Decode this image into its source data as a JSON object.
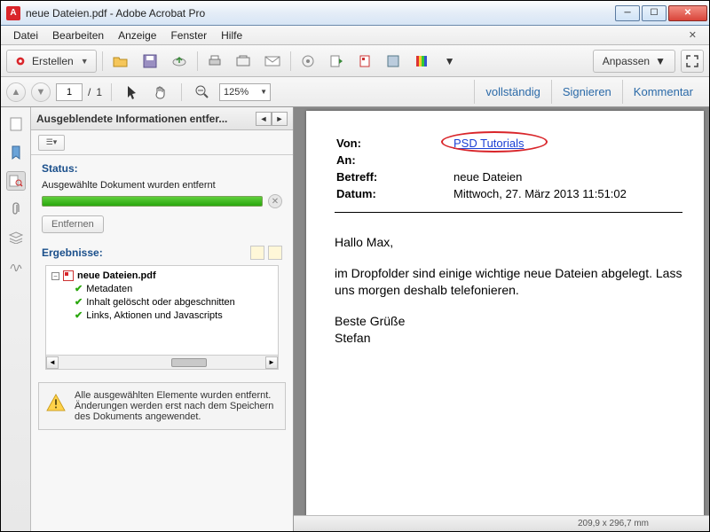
{
  "window": {
    "title": "neue Dateien.pdf - Adobe Acrobat Pro"
  },
  "menu": {
    "items": [
      "Datei",
      "Bearbeiten",
      "Anzeige",
      "Fenster",
      "Hilfe"
    ]
  },
  "toolbar": {
    "create_label": "Erstellen",
    "anpassen_label": "Anpassen"
  },
  "nav": {
    "page_current": "1",
    "page_total": "1",
    "zoom": "125%",
    "links": [
      "vollständig",
      "Signieren",
      "Kommentar"
    ]
  },
  "panel": {
    "title": "Ausgeblendete Informationen entfer...",
    "status_heading": "Status:",
    "status_msg": "Ausgewählte Dokument wurden entfernt",
    "remove_btn": "Entfernen",
    "results_heading": "Ergebnisse:",
    "tree_root": "neue Dateien.pdf",
    "tree_items": [
      "Metadaten",
      "Inhalt gelöscht oder abgeschnitten",
      "Links, Aktionen und Javascripts"
    ],
    "notice": "Alle ausgewählten Elemente wurden entfernt. Änderungen werden erst nach dem Speichern des Dokuments angewendet."
  },
  "doc": {
    "labels": {
      "from": "Von:",
      "to": "An:",
      "subject": "Betreff:",
      "date": "Datum:"
    },
    "from_value": "PSD Tutorials",
    "subject_value": "neue Dateien",
    "date_value": "Mittwoch, 27. März 2013 11:51:02",
    "greeting": "Hallo Max,",
    "para": "im Dropfolder sind einige wichtige neue Dateien abgelegt. Lass uns morgen deshalb telefonieren.",
    "closing1": "Beste Grüße",
    "closing2": "Stefan"
  },
  "status": {
    "dims": "209,9 x 296,7 mm"
  }
}
